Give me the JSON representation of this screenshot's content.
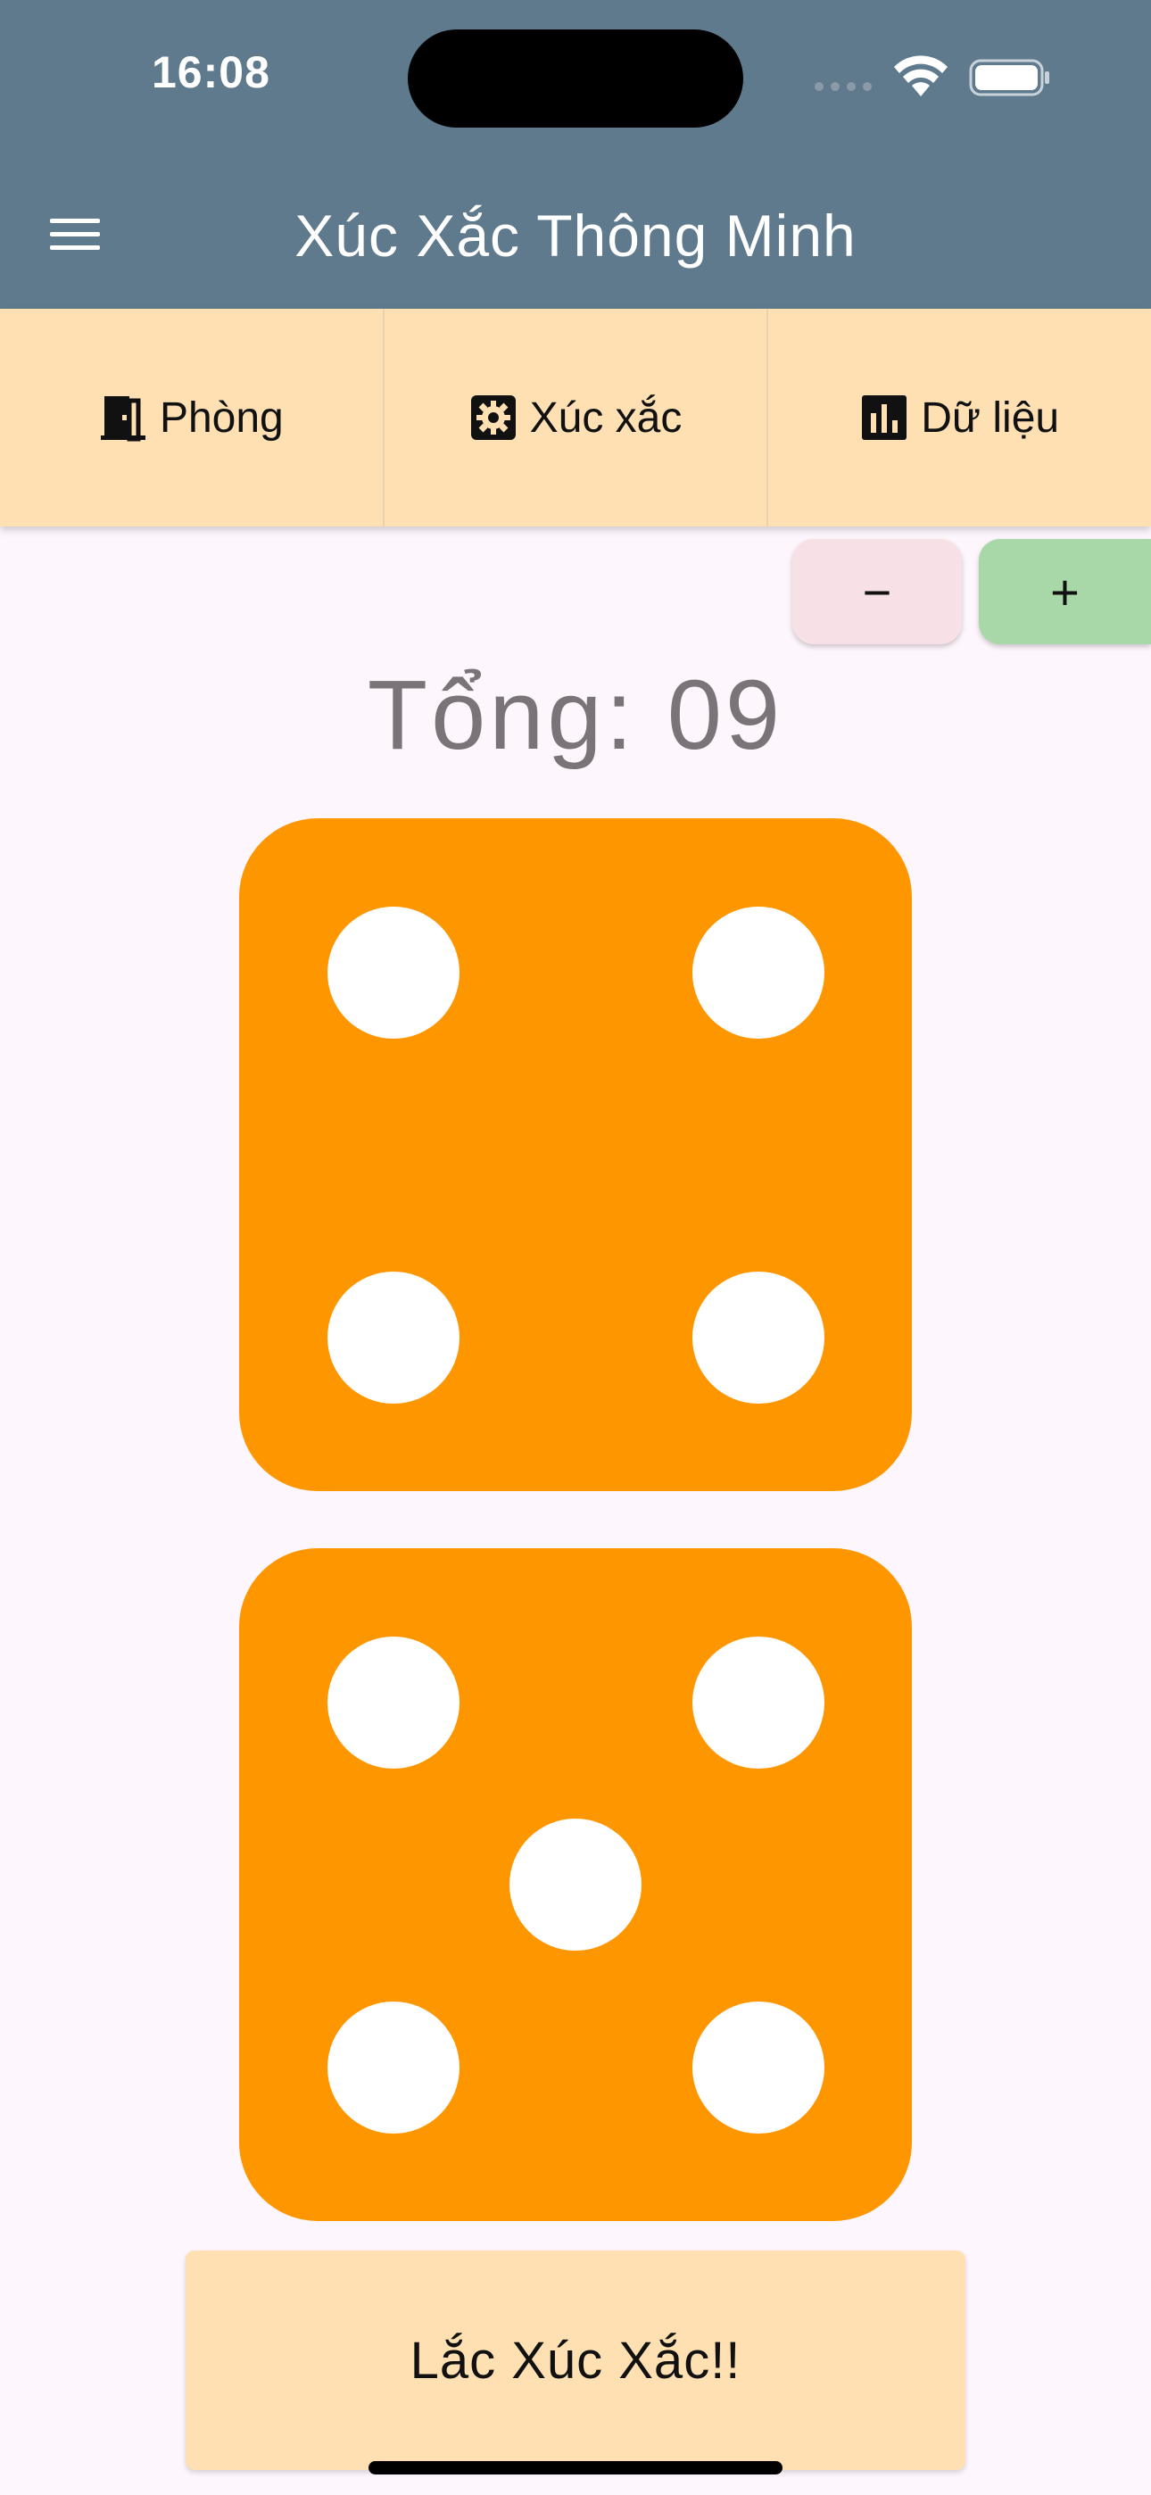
{
  "status_bar": {
    "time": "16:08"
  },
  "app_bar": {
    "title": "Xúc Xắc Thông Minh",
    "background": "#5f7a8d"
  },
  "tabs": [
    {
      "label": "Phòng",
      "icon": "door-icon"
    },
    {
      "label": "Xúc xắc",
      "icon": "settings-gear-icon"
    },
    {
      "label": "Dữ liệu",
      "icon": "bar-chart-icon"
    }
  ],
  "stepper": {
    "minus_label": "−",
    "plus_label": "+"
  },
  "total": {
    "text": "Tổng: 09",
    "value": 9
  },
  "dice": {
    "color": "#fe9600",
    "values": [
      4,
      5
    ]
  },
  "roll_button": {
    "label": "Lắc Xúc Xắc!!"
  }
}
